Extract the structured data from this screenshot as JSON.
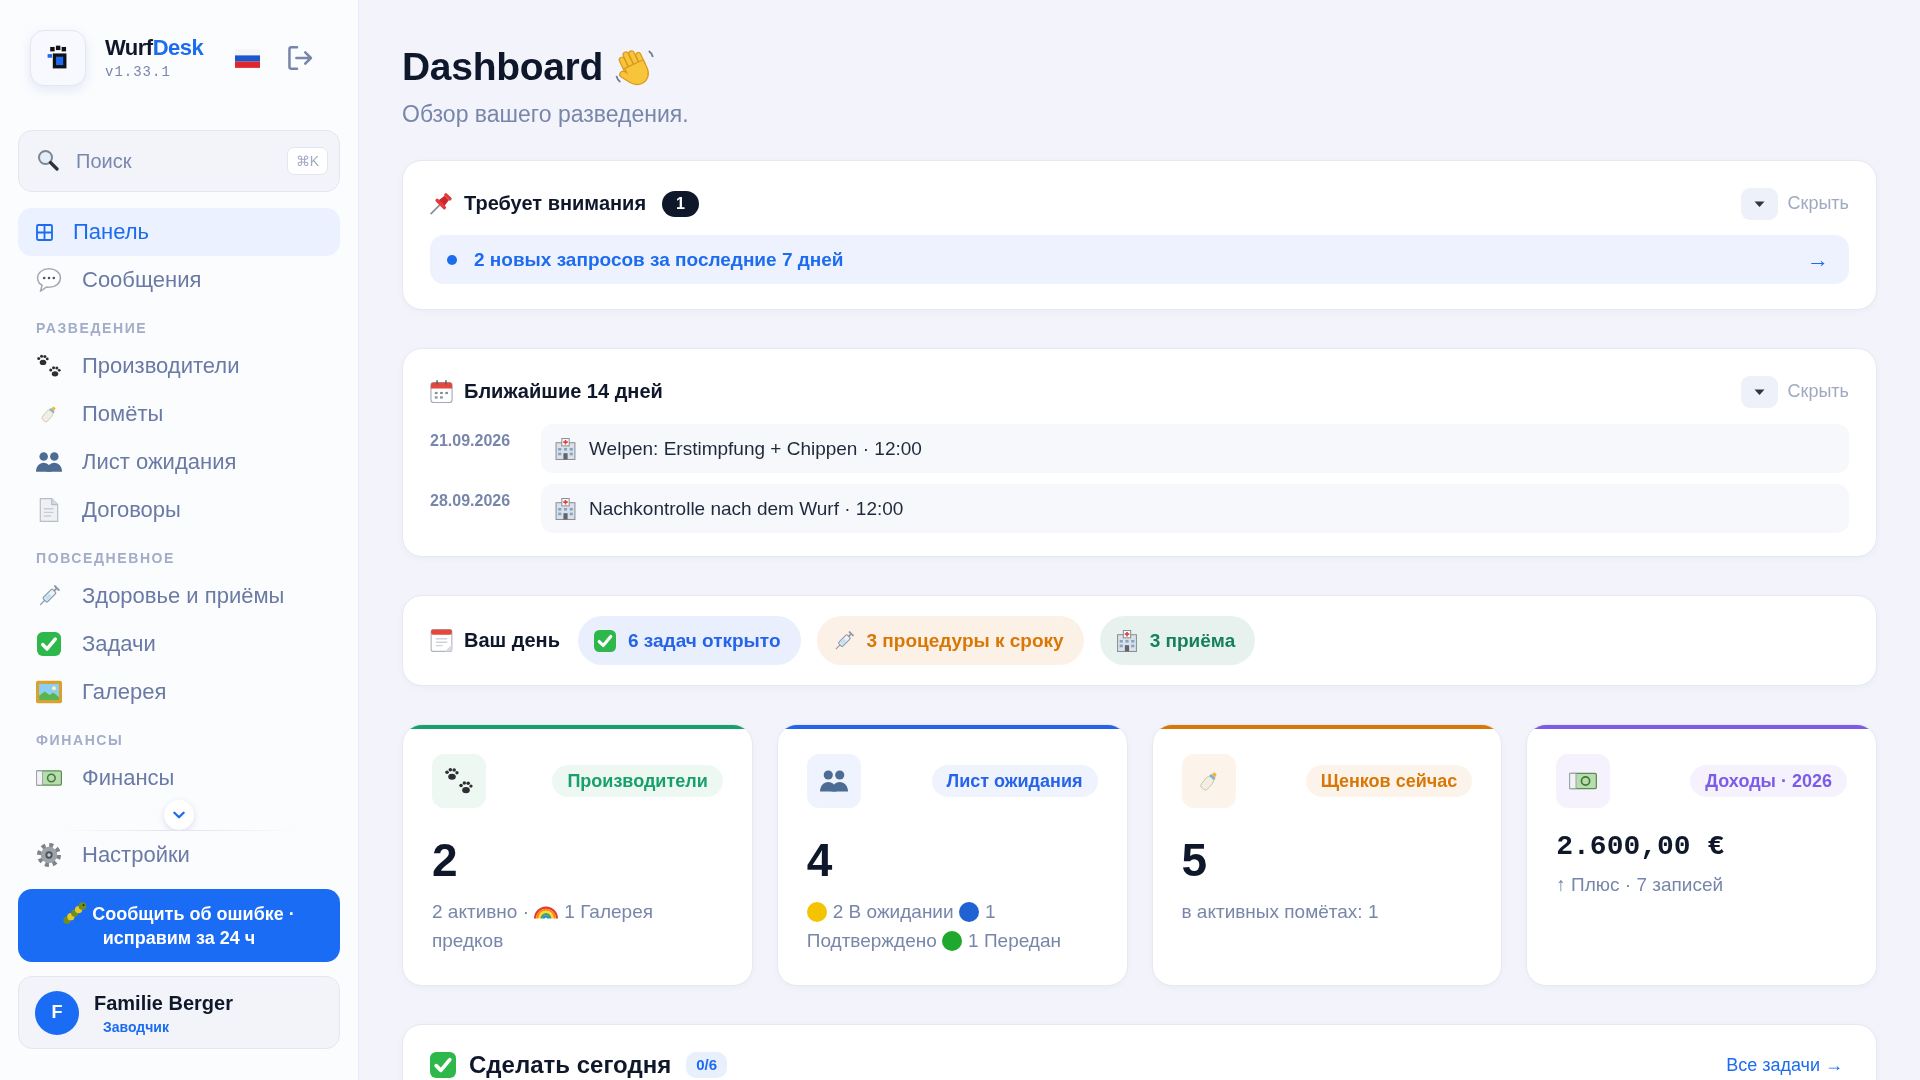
{
  "sidebar": {
    "brand": [
      {
        "text": "Wurf",
        "accent": false
      },
      {
        "text": "Desk",
        "accent": true
      }
    ],
    "version": "v1.33.1",
    "search": {
      "placeholder": "Поиск",
      "shortcut": "⌘K"
    },
    "nav_sections": [
      {
        "items": [
          {
            "label": "Панель",
            "selected": true
          },
          {
            "label": "Сообщения",
            "selected": false
          }
        ]
      },
      {
        "heading": "РАЗВЕДЕНИЕ",
        "items": [
          {
            "label": "Производители",
            "selected": false
          },
          {
            "label": "Помёты",
            "selected": false
          },
          {
            "label": "Лист ожидания",
            "selected": false
          },
          {
            "label": "Договоры",
            "selected": false
          }
        ]
      },
      {
        "heading": "ПОВСЕДНЕВНОЕ",
        "items": [
          {
            "label": "Здоровье и приёмы",
            "selected": false
          },
          {
            "label": "Задачи",
            "selected": false
          },
          {
            "label": "Галерея",
            "selected": false
          }
        ]
      },
      {
        "heading": "ФИНАНСЫ",
        "items": [
          {
            "label": "Финансы",
            "selected": false
          }
        ]
      }
    ],
    "bottom_items": [
      {
        "label": "Настройки",
        "selected": false
      }
    ],
    "report_button": "Сообщить об ошибке · исправим за 24 ч",
    "user": {
      "avatar_letter": "F",
      "name": "Familie Berger",
      "role": "Заводчик"
    }
  },
  "header": {
    "title": "Dashboard",
    "subtitle": "Обзор вашего разведения."
  },
  "attention": {
    "title": "Требует внимания",
    "count": "1",
    "hide_label": "Скрыть",
    "items": [
      {
        "text": "2 новых запросов за последние 7 дней",
        "arrow": "→"
      }
    ]
  },
  "upcoming": {
    "title": "Ближайшие 14 дней",
    "hide_label": "Скрыть",
    "events": [
      {
        "date": "21.09.2026",
        "text": "Welpen: Erstimpfung + Chippen · 12:00"
      },
      {
        "date": "28.09.2026",
        "text": "Nachkontrolle nach dem Wurf · 12:00"
      }
    ]
  },
  "your_day": {
    "title": "Ваш день",
    "pills": [
      {
        "text": "6 задач открыто",
        "color": "#2563eb"
      },
      {
        "text": "3 процедуры к сроку",
        "color": "#d97706"
      },
      {
        "text": "3 приёма",
        "color": "#15805a"
      }
    ]
  },
  "stats": [
    {
      "kind": "count",
      "label": "Производители",
      "value": "2",
      "color": "#17a06b",
      "details": [
        {
          "kind": "text",
          "text": "2 активно ·"
        },
        {
          "kind": "rainbow",
          "text": "1 Галерея"
        },
        {
          "kind": "text",
          "text": "предков"
        }
      ]
    },
    {
      "kind": "count",
      "label": "Лист ожидания",
      "value": "4",
      "color": "#2563eb",
      "details": [
        {
          "kind": "dot",
          "color": "#f5c400",
          "text": "2 В ожидании"
        },
        {
          "kind": "dot",
          "color": "#1f62d4",
          "text": "1"
        },
        {
          "kind": "text",
          "text": "Подтверждено"
        },
        {
          "kind": "dot",
          "color": "#1fa82e",
          "text": "1 Передан"
        }
      ]
    },
    {
      "kind": "count",
      "label": "Щенков сейчас",
      "value": "5",
      "color": "#d97706",
      "details": [
        {
          "kind": "text",
          "text": "в активных помётах: 1"
        }
      ]
    },
    {
      "kind": "money",
      "label": "Доходы · 2026",
      "value": "2.600,00 €",
      "color": "#7c5ce6",
      "details": [
        {
          "kind": "text",
          "text": "↑ Плюс · 7 записей"
        }
      ]
    }
  ],
  "todo": {
    "title": "Сделать сегодня",
    "count": "0/6",
    "link": "Все задачи →"
  }
}
